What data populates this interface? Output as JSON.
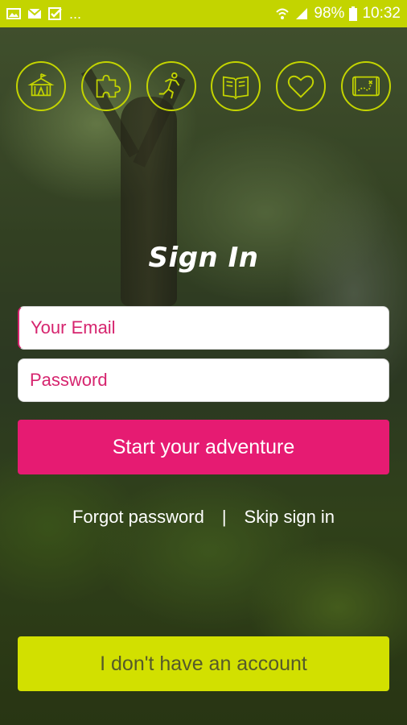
{
  "status_bar": {
    "ellipsis": "...",
    "battery": "98%",
    "time": "10:32"
  },
  "icons": [
    {
      "name": "circus-tent-icon"
    },
    {
      "name": "puzzle-icon"
    },
    {
      "name": "running-person-icon"
    },
    {
      "name": "book-icon"
    },
    {
      "name": "heart-icon"
    },
    {
      "name": "treasure-map-icon"
    }
  ],
  "title": "Sign In",
  "form": {
    "email_placeholder": "Your Email",
    "email_value": "",
    "password_placeholder": "Password",
    "password_value": "",
    "submit_label": "Start your adventure"
  },
  "links": {
    "forgot_password": "Forgot password",
    "separator": "|",
    "skip_sign_in": "Skip sign in"
  },
  "no_account_label": "I don't have an account",
  "colors": {
    "accent_lime": "#c3d400",
    "accent_pink": "#e61b72",
    "button_lime": "#d2e000"
  }
}
